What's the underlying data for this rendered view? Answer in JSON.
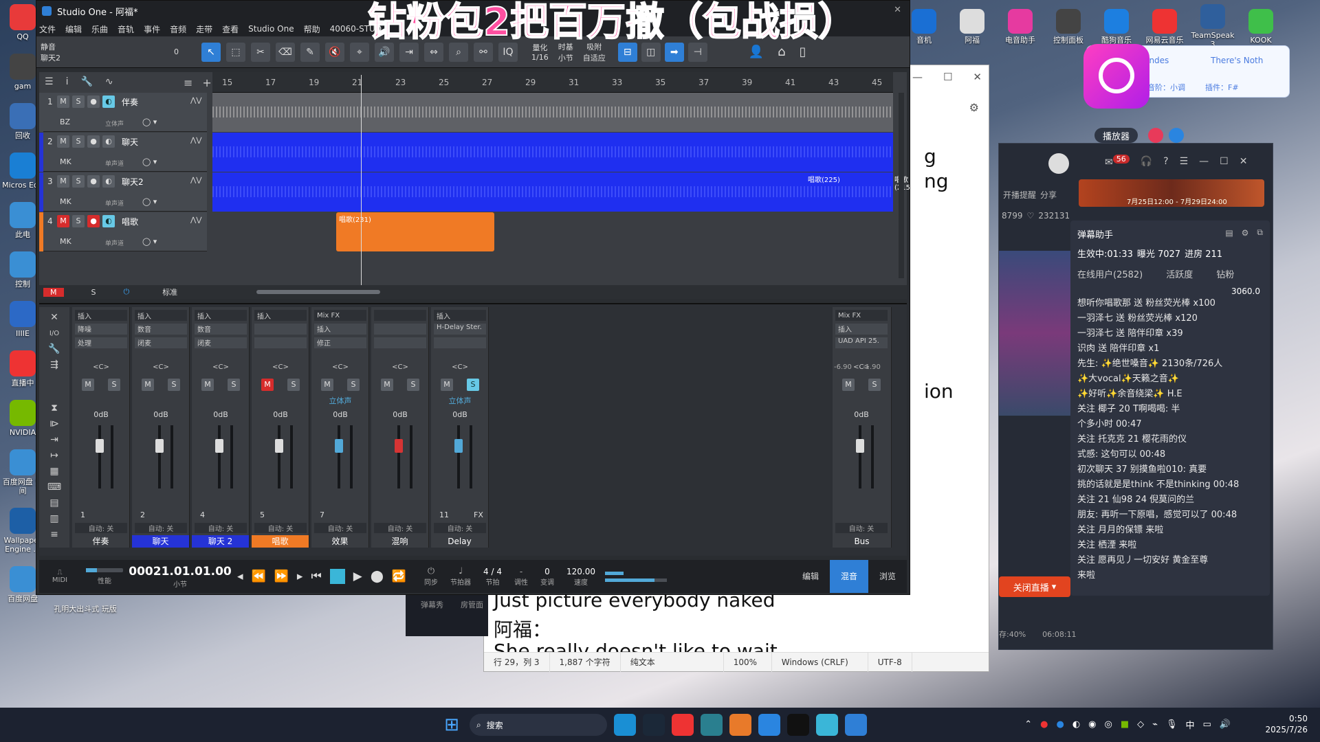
{
  "overlay_banner": "钻粉包2把百万撤（包战损）",
  "desktop": {
    "left_icons": [
      {
        "label": "QQ",
        "color": "#e83a3a"
      },
      {
        "label": "gam",
        "color": "#444"
      },
      {
        "label": "回收",
        "color": "#3a6fb6"
      },
      {
        "label": "Micros Edg",
        "color": "#1a7fd4"
      },
      {
        "label": "此电",
        "color": "#3a8fd4"
      },
      {
        "label": "控制",
        "color": "#3a8fd4"
      },
      {
        "label": "IIIIE",
        "color": "#2c69c6"
      },
      {
        "label": "直播中",
        "color": "#e33"
      },
      {
        "label": "NVIDIA",
        "color": "#76b900"
      },
      {
        "label": "百度网盘 空间",
        "color": "#3a8fd4"
      },
      {
        "label": "Wallpaper Engine ...",
        "color": "#1d5fa6"
      },
      {
        "label": "百度网盘",
        "color": "#3a8fd4"
      }
    ],
    "middle_icons": [
      {
        "label": "孔明大出斗式 玩版"
      }
    ],
    "top_icons": [
      {
        "label": "音机",
        "color": "#1a6fd4"
      },
      {
        "label": "阿福",
        "color": "#ddd"
      },
      {
        "label": "电音助手",
        "color": "#e63aa0"
      },
      {
        "label": "控制面板",
        "color": "#444"
      },
      {
        "label": "酷狗音乐",
        "color": "#1d7fe0"
      },
      {
        "label": "网易云音乐",
        "color": "#e33"
      },
      {
        "label": "TeamSpeak 3",
        "color": "#2f5f9c"
      },
      {
        "label": "KOOK",
        "color": "#3fbf4a"
      }
    ]
  },
  "music_widget": {
    "now_playing": "k - Shawn Mendes",
    "now_playing_2": "There's Noth",
    "key": "基调：F#",
    "scale": "音阶：小调",
    "plugin": "插件：F#",
    "player_label": "播放器"
  },
  "notepad": {
    "lines": [
      "g",
      "ng",
      "ion"
    ],
    "lyric1": "Just picture everybody naked",
    "lyric2": "阿福：",
    "lyric3": "She really doesn't like to wait",
    "status": {
      "position": "行 29，列 3",
      "chars": "1,887 个字符",
      "type": "纯文本",
      "zoom": "100%",
      "eol": "Windows (CRLF)",
      "encoding": "UTF-8"
    }
  },
  "chat_panel": {
    "header_count": "56",
    "reminder": "开播提醒",
    "share": "分享",
    "banner_text": "7月25日12:00 - 7月29日24:00",
    "fans": "8799",
    "likes": "232131",
    "title": "弹幕助手",
    "effect": "生效中:01:33",
    "exposure": "曝光 7027",
    "progress": "进房 211",
    "tabs": [
      "在线用户(2582)",
      "活跃度",
      "钻粉"
    ],
    "score": "3060.0",
    "messages": [
      "想听你唱歌那 送 粉丝荧光棒 x100",
      "一羽泽七 送 粉丝荧光棒 x120",
      "一羽泽七 送 陪伴印章 x39",
      "识肉 送 陪伴印章 x1",
      "先生: ✨绝世嗓音✨ 2130条/726人",
      "✨大vocal✨天籁之音✨",
      "✨好听✨余音绕梁✨ H.E",
      "关注 椰子 20 T啊喝喝: 半",
      "个多小时 00:47",
      "关注 托克克 21 樱花雨的仪",
      "式感: 这句可以 00:48",
      "初次聊天 37 别摸鱼啦010: 真要",
      "挑的话就是是think 不是thinking 00:48",
      "关注 21 仙98 24 倪莫问的兰",
      "朋友: 再听一下原唱，感觉可以了 00:48",
      "关注 月月的保镖 来啦",
      "关注 栖湮 来啦",
      "关注 愿再见丿一切安好 黄金至尊",
      "来啦"
    ],
    "close_live": "关闭直播",
    "side_items": [
      "弹幕秀",
      "房管面"
    ],
    "cpu": "存:40%",
    "time": "06:08:11"
  },
  "daw": {
    "title": "Studio One - 阿福*",
    "menu": [
      "文件",
      "编辑",
      "乐曲",
      "音轨",
      "事件",
      "音频",
      "走带",
      "查看",
      "Studio One",
      "帮助",
      "40060-STUD"
    ],
    "toolbar": {
      "track_name": "聊天2",
      "mode": "静音",
      "quantize_label": "量化",
      "quantize": "1/16",
      "timebase_label": "时基",
      "timebase": "小节",
      "snap_label": "吸附",
      "snap": "自适应",
      "count": "0"
    },
    "ruler": [
      "15",
      "17",
      "19",
      "21",
      "23",
      "25",
      "27",
      "29",
      "31",
      "33",
      "35",
      "37",
      "39",
      "41",
      "43",
      "45"
    ],
    "tracks": [
      {
        "num": "1",
        "name": "伴奏",
        "input": "BZ",
        "mode": "立体声",
        "lane_color": "#5f6166"
      },
      {
        "num": "2",
        "name": "聊天",
        "input": "MK",
        "mode": "单声道",
        "lane_color": "#1f2ff0"
      },
      {
        "num": "3",
        "name": "聊天2",
        "input": "MK",
        "mode": "单声道",
        "lane_color": "#1f2ff0"
      },
      {
        "num": "4",
        "name": "唱歌",
        "input": "MK",
        "mode": "单声道",
        "lane_color": "#3a3d42"
      }
    ],
    "clips": {
      "c1": "唱歌(231)",
      "c2": "唱歌(225)",
      "c3": "唱歌(215)"
    },
    "arr_bottom": {
      "m": "M",
      "s": "S",
      "std": "标准"
    },
    "mixer": {
      "strips": [
        {
          "num": "1",
          "name": "伴奏",
          "name_bg": "#393c41",
          "insert": "插入",
          "fx1": "降噪",
          "fx2": "处理",
          "db": "0dB",
          "auto": "自动: 关",
          "m_red": false,
          "fader_color": "#ddd"
        },
        {
          "num": "2",
          "name": "聊天",
          "name_bg": "#2533d6",
          "insert": "插入",
          "fx1": "数音",
          "fx2": "闭麦",
          "db": "0dB",
          "auto": "自动: 关",
          "m_red": false,
          "fader_color": "#ddd"
        },
        {
          "num": "4",
          "name": "聊天 2",
          "name_bg": "#2533d6",
          "insert": "插入",
          "fx1": "数音",
          "fx2": "闭麦",
          "db": "0dB",
          "auto": "自动: 关",
          "m_red": false,
          "fader_color": "#ddd"
        },
        {
          "num": "5",
          "name": "唱歌",
          "name_bg": "#f07a25",
          "insert": "插入",
          "fx1": "",
          "fx2": "",
          "db": "0dB",
          "auto": "自动: 关",
          "m_red": true,
          "fader_color": "#ddd"
        },
        {
          "num": "7",
          "name": "效果",
          "name_bg": "#393c41",
          "insert": "Mix FX",
          "fx1": "插入",
          "fx2": "修正",
          "db": "0dB",
          "auto": "自动: 关",
          "m_red": false,
          "fader_color": "#52a9d8",
          "stereo": "立体声"
        },
        {
          "num": "",
          "name": "混响",
          "name_bg": "#393c41",
          "insert": "",
          "fx1": "",
          "fx2": "",
          "db": "0dB",
          "auto": "自动: 关",
          "m_red": false,
          "fader_color": "#d63434"
        },
        {
          "num": "11",
          "name": "Delay",
          "name_bg": "#393c41",
          "insert": "插入",
          "fx1": "H-Delay Ster.",
          "fx2": "",
          "db": "0dB",
          "auto": "自动: 关",
          "m_red": false,
          "fader_color": "#52a9d8",
          "stereo": "立体声",
          "fx_label": "FX"
        }
      ],
      "bus": {
        "name": "Bus",
        "insert": "Mix FX",
        "fx1": "插入",
        "fx2": "UAD API 25.",
        "peak_l": "-6.90",
        "peak_r": "-1.90",
        "db": "0dB",
        "auto": "自动: 关"
      }
    },
    "transport": {
      "midi": "MIDI",
      "perf": "性能",
      "time": "00021.01.01.00",
      "time_unit": "小节",
      "sync": "同步",
      "metronome": "节拍器",
      "sig": "4 / 4",
      "sig_label": "节拍",
      "key_label": "调性",
      "transpose": "0",
      "transpose_label": "变调",
      "tempo": "120.00",
      "tempo_label": "速度",
      "tabs": [
        "编辑",
        "混音",
        "浏览"
      ]
    }
  },
  "taskbar": {
    "search": "搜索",
    "time": "0:50",
    "date": "2025/7/26",
    "ime": "中"
  }
}
